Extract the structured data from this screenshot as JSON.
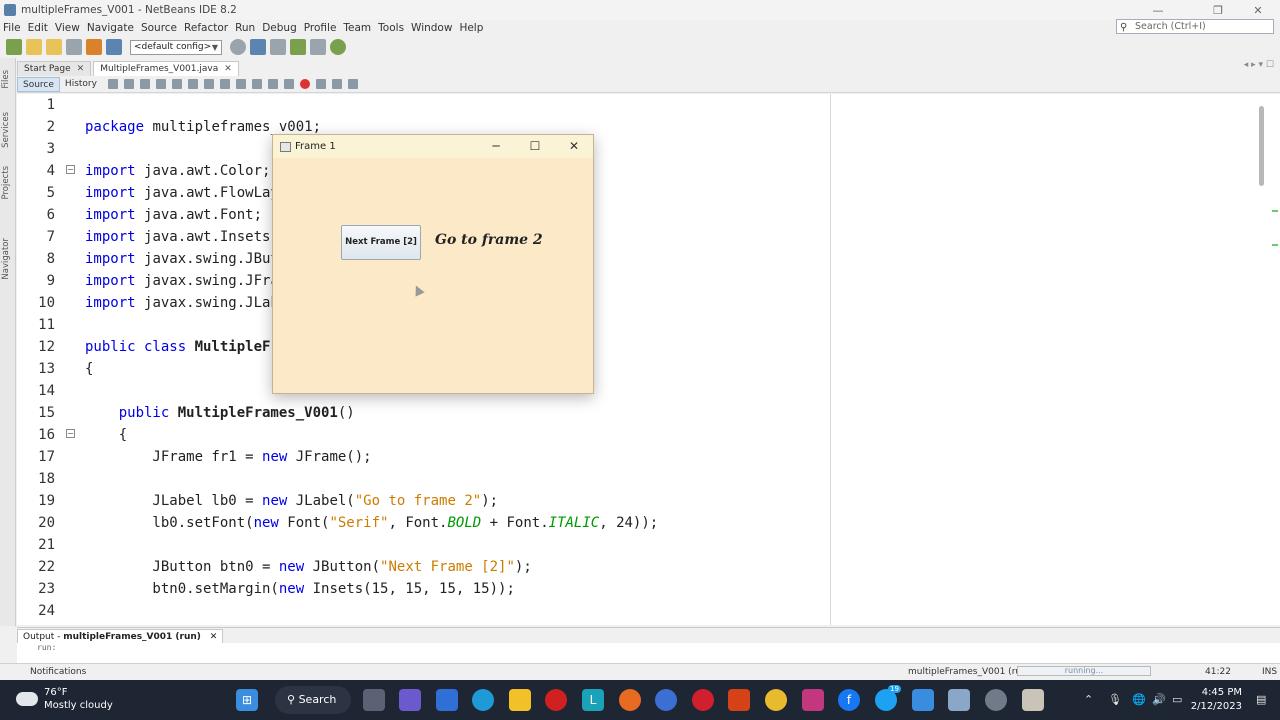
{
  "window": {
    "title": "multipleFrames_V001 - NetBeans IDE 8.2",
    "min": "—",
    "max": "❐",
    "close": "✕"
  },
  "menu": [
    "File",
    "Edit",
    "View",
    "Navigate",
    "Source",
    "Refactor",
    "Run",
    "Debug",
    "Profile",
    "Team",
    "Tools",
    "Window",
    "Help"
  ],
  "search": {
    "placeholder": "Search (Ctrl+I)"
  },
  "toolbar": {
    "config": "<default config>"
  },
  "side_panels": [
    "Files",
    "Services",
    "Projects",
    "Navigator"
  ],
  "tabs": [
    {
      "label": "Start Page",
      "close": "✕"
    },
    {
      "label": "MultipleFrames_V001.java",
      "close": "✕"
    }
  ],
  "editor_bar": {
    "source": "Source",
    "history": "History"
  },
  "code_lines": [
    {
      "n": "1",
      "segs": []
    },
    {
      "n": "2",
      "segs": [
        {
          "t": "package ",
          "c": "kw"
        },
        {
          "t": "multipleframes_v001;",
          "c": ""
        }
      ]
    },
    {
      "n": "3",
      "segs": []
    },
    {
      "n": "4",
      "segs": [
        {
          "t": "import ",
          "c": "kw"
        },
        {
          "t": "java.awt.Color;",
          "c": ""
        }
      ]
    },
    {
      "n": "5",
      "segs": [
        {
          "t": "import ",
          "c": "kw"
        },
        {
          "t": "java.awt.FlowLayout;",
          "c": ""
        }
      ]
    },
    {
      "n": "6",
      "segs": [
        {
          "t": "import ",
          "c": "kw"
        },
        {
          "t": "java.awt.Font;",
          "c": ""
        }
      ]
    },
    {
      "n": "7",
      "segs": [
        {
          "t": "import ",
          "c": "kw"
        },
        {
          "t": "java.awt.Insets;",
          "c": ""
        }
      ]
    },
    {
      "n": "8",
      "segs": [
        {
          "t": "import ",
          "c": "kw"
        },
        {
          "t": "javax.swing.JButton;",
          "c": ""
        }
      ]
    },
    {
      "n": "9",
      "segs": [
        {
          "t": "import ",
          "c": "kw"
        },
        {
          "t": "javax.swing.JFrame;",
          "c": ""
        }
      ]
    },
    {
      "n": "10",
      "segs": [
        {
          "t": "import ",
          "c": "kw"
        },
        {
          "t": "javax.swing.JLabel;",
          "c": ""
        }
      ]
    },
    {
      "n": "11",
      "segs": []
    },
    {
      "n": "12",
      "segs": [
        {
          "t": "public class ",
          "c": "kw"
        },
        {
          "t": "MultipleFrames_V001",
          "c": "bold"
        }
      ]
    },
    {
      "n": "13",
      "segs": [
        {
          "t": "{",
          "c": ""
        }
      ]
    },
    {
      "n": "14",
      "segs": []
    },
    {
      "n": "15",
      "segs": [
        {
          "t": "    public ",
          "c": "kw"
        },
        {
          "t": "MultipleFrames_V001",
          "c": "bold"
        },
        {
          "t": "()",
          "c": ""
        }
      ]
    },
    {
      "n": "16",
      "segs": [
        {
          "t": "    {",
          "c": ""
        }
      ]
    },
    {
      "n": "17",
      "segs": [
        {
          "t": "        JFrame fr1 = ",
          "c": ""
        },
        {
          "t": "new ",
          "c": "kw"
        },
        {
          "t": "JFrame();",
          "c": ""
        }
      ]
    },
    {
      "n": "18",
      "segs": []
    },
    {
      "n": "19",
      "segs": [
        {
          "t": "        JLabel lb0 = ",
          "c": ""
        },
        {
          "t": "new ",
          "c": "kw"
        },
        {
          "t": "JLabel(",
          "c": ""
        },
        {
          "t": "\"Go to frame 2\"",
          "c": "str"
        },
        {
          "t": ");",
          "c": ""
        }
      ]
    },
    {
      "n": "20",
      "segs": [
        {
          "t": "        lb0.setFont(",
          "c": ""
        },
        {
          "t": "new ",
          "c": "kw"
        },
        {
          "t": "Font(",
          "c": ""
        },
        {
          "t": "\"Serif\"",
          "c": "str"
        },
        {
          "t": ", Font.",
          "c": ""
        },
        {
          "t": "BOLD",
          "c": "it"
        },
        {
          "t": " + Font.",
          "c": ""
        },
        {
          "t": "ITALIC",
          "c": "it"
        },
        {
          "t": ", 24));",
          "c": ""
        }
      ]
    },
    {
      "n": "21",
      "segs": []
    },
    {
      "n": "22",
      "segs": [
        {
          "t": "        JButton btn0 = ",
          "c": ""
        },
        {
          "t": "new ",
          "c": "kw"
        },
        {
          "t": "JButton(",
          "c": ""
        },
        {
          "t": "\"Next Frame [2]\"",
          "c": "str"
        },
        {
          "t": ");",
          "c": ""
        }
      ]
    },
    {
      "n": "23",
      "segs": [
        {
          "t": "        btn0.setMargin(",
          "c": ""
        },
        {
          "t": "new ",
          "c": "kw"
        },
        {
          "t": "Insets(15, 15, 15, 15));",
          "c": ""
        }
      ]
    },
    {
      "n": "24",
      "segs": []
    }
  ],
  "frame1": {
    "title": "Frame 1",
    "button": "Next Frame [2]",
    "label": "Go to frame 2",
    "min": "─",
    "max": "☐",
    "close": "✕"
  },
  "output": {
    "tab_prefix": "Output - ",
    "tab_name": "multipleFrames_V001 (run)",
    "close": "✕",
    "text": "run:"
  },
  "status": {
    "notifications": "Notifications",
    "task": "multipleFrames_V001 (run)",
    "progress": "running...",
    "position": "41:22",
    "mode": "INS"
  },
  "taskbar": {
    "temp": "76°F",
    "weather": "Mostly cloudy",
    "search": "Search",
    "time": "4:45 PM",
    "date": "2/12/2023",
    "badge": "19"
  },
  "colors": {
    "keyword": "#0000e6",
    "string": "#ce7b00",
    "frame_bg": "#fbe9c8",
    "taskbar_bg": "#1e2533"
  }
}
